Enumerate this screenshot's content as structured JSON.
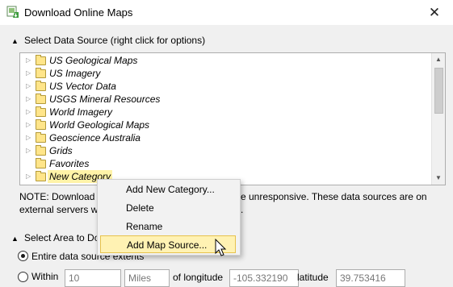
{
  "window": {
    "title": "Download Online Maps",
    "close_icon": "close-icon"
  },
  "data_source": {
    "header": "Select Data Source (right click for options)",
    "items": [
      {
        "label": "US Geological Maps"
      },
      {
        "label": "US Imagery"
      },
      {
        "label": "US Vector Data"
      },
      {
        "label": "USGS Mineral Resources"
      },
      {
        "label": "World Imagery"
      },
      {
        "label": "World Geological Maps"
      },
      {
        "label": "Geoscience Australia"
      },
      {
        "label": "Grids"
      },
      {
        "label": "Favorites"
      },
      {
        "label": "New Category"
      }
    ]
  },
  "note": {
    "line1_a": "NOTE: Download s",
    "line1_b": "e unresponsive.  These data sources are on",
    "line2_a": "external servers wh",
    "line2_b": "."
  },
  "area": {
    "header": "Select Area to Do",
    "option_entire": "Entire data source extents",
    "option_within": "Within",
    "within_value": "10",
    "unit_value": "Miles",
    "longitude_label": "of longitude",
    "longitude_value": "-105.332190",
    "latitude_label": "latitude",
    "latitude_value": "39.753416"
  },
  "context_menu": {
    "items": [
      {
        "label": "Add New Category..."
      },
      {
        "label": "Delete"
      },
      {
        "label": "Rename"
      },
      {
        "label": "Add Map Source..."
      }
    ],
    "highlighted_index": 3
  },
  "colors": {
    "menu_highlight": "#fff2b3",
    "selection": "#fff3a8",
    "folder": "#ffe58a"
  }
}
